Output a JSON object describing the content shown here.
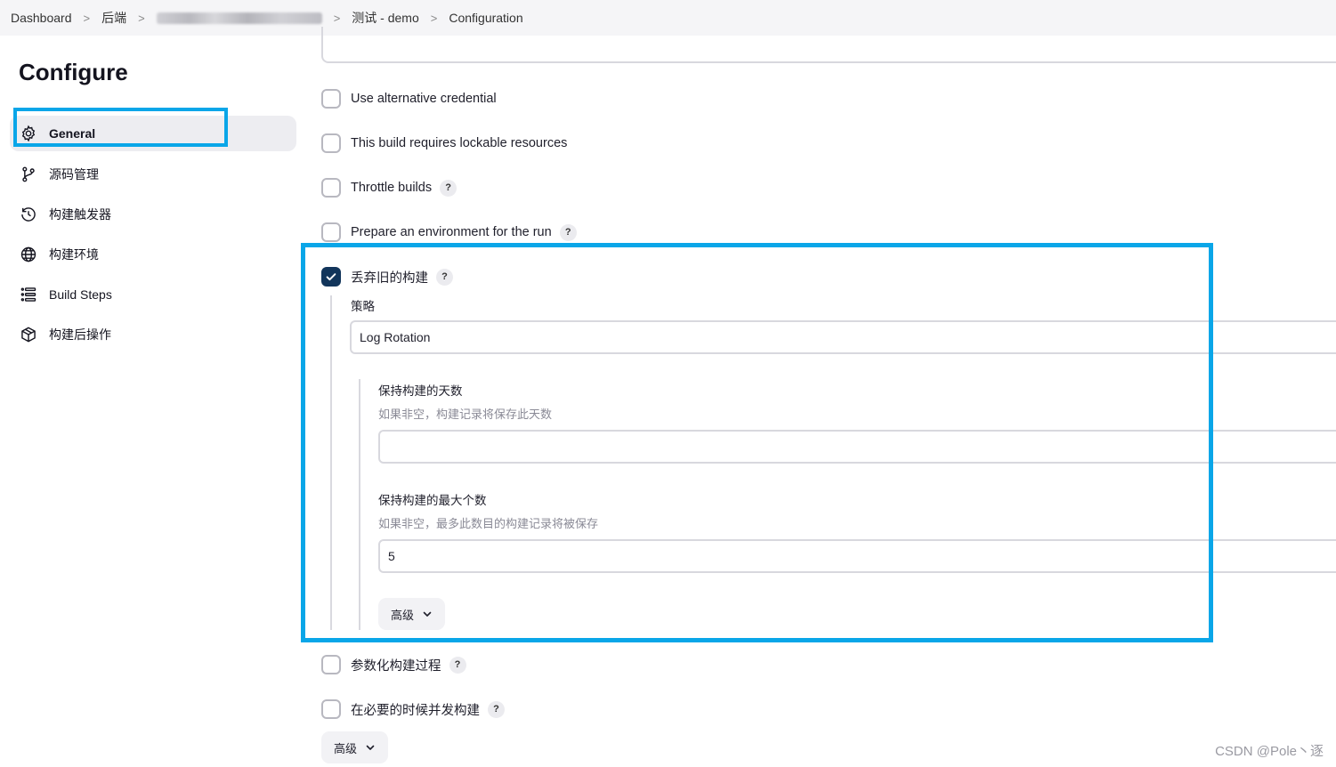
{
  "breadcrumb": {
    "items": [
      "Dashboard",
      "后端",
      "测试 - demo",
      "Configuration"
    ],
    "separator": ">"
  },
  "sidebar": {
    "title": "Configure",
    "items": [
      {
        "label": "General",
        "icon": "gear-icon",
        "active": true
      },
      {
        "label": "源码管理",
        "icon": "branch-icon"
      },
      {
        "label": "构建触发器",
        "icon": "clock-icon"
      },
      {
        "label": "构建环境",
        "icon": "globe-icon"
      },
      {
        "label": "Build Steps",
        "icon": "list-icon"
      },
      {
        "label": "构建后操作",
        "icon": "package-icon"
      }
    ]
  },
  "options": {
    "alt_credential": {
      "label": "Use alternative credential",
      "checked": false
    },
    "lockable": {
      "label": "This build requires lockable resources",
      "checked": false
    },
    "throttle": {
      "label": "Throttle builds",
      "checked": false
    },
    "prepare_env": {
      "label": "Prepare an environment for the run",
      "checked": false
    },
    "discard": {
      "label": "丢弃旧的构建",
      "checked": true
    },
    "parameterized": {
      "label": "参数化构建过程",
      "checked": false
    },
    "concurrent": {
      "label": "在必要的时候并发构建",
      "checked": false
    }
  },
  "discard_settings": {
    "strategy_label": "策略",
    "strategy_value": "Log Rotation",
    "days_title": "保持构建的天数",
    "days_desc": "如果非空，构建记录将保存此天数",
    "days_value": "",
    "max_title": "保持构建的最大个数",
    "max_desc": "如果非空，最多此数目的构建记录将被保存",
    "max_value": "5",
    "advanced_label": "高级"
  },
  "advanced_button_label": "高级",
  "help_glyph": "?",
  "watermark": "CSDN @Pole丶逐",
  "colors": {
    "highlight": "#0aa6e8",
    "checkbox_checked": "#12355b",
    "active_nav_bg": "#ededf1"
  }
}
